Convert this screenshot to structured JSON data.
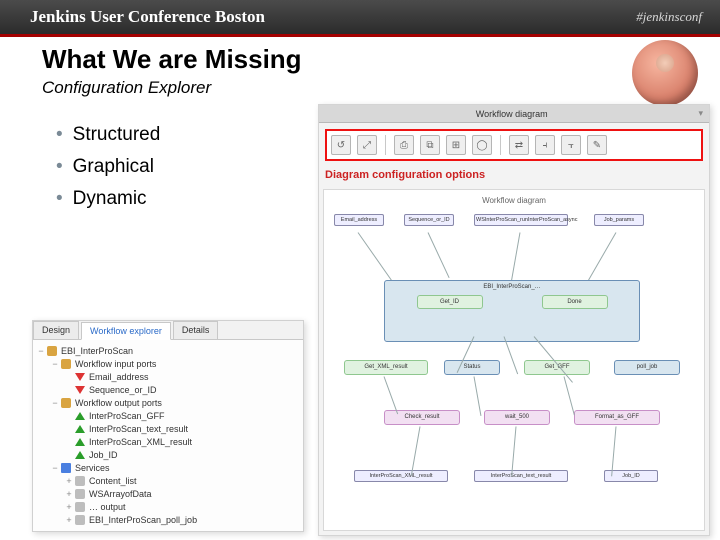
{
  "header": {
    "title": "Jenkins User Conference Boston",
    "tag": "#jenkinsconf"
  },
  "title": "What We are Missing",
  "subtitle": "Configuration Explorer",
  "bullets": [
    "Structured",
    "Graphical",
    "Dynamic"
  ],
  "left": {
    "tabs": [
      "Design",
      "Workflow explorer",
      "Details"
    ],
    "active_tab_index": 1,
    "tree": [
      {
        "lvl": 0,
        "tw": "−",
        "icon": "fld",
        "label": "EBI_InterProScan"
      },
      {
        "lvl": 1,
        "tw": "−",
        "icon": "fld",
        "label": "Workflow input ports"
      },
      {
        "lvl": 2,
        "tw": "",
        "icon": "dn",
        "label": "Email_address"
      },
      {
        "lvl": 2,
        "tw": "",
        "icon": "dn",
        "label": "Sequence_or_ID"
      },
      {
        "lvl": 1,
        "tw": "−",
        "icon": "fld",
        "label": "Workflow output ports"
      },
      {
        "lvl": 2,
        "tw": "",
        "icon": "up",
        "label": "InterProScan_GFF"
      },
      {
        "lvl": 2,
        "tw": "",
        "icon": "up",
        "label": "InterProScan_text_result"
      },
      {
        "lvl": 2,
        "tw": "",
        "icon": "up",
        "label": "InterProScan_XML_result"
      },
      {
        "lvl": 2,
        "tw": "",
        "icon": "up",
        "label": "Job_ID"
      },
      {
        "lvl": 1,
        "tw": "−",
        "icon": "svc",
        "label": "Services"
      },
      {
        "lvl": 2,
        "tw": "+",
        "icon": "doc",
        "label": "Content_list"
      },
      {
        "lvl": 2,
        "tw": "+",
        "icon": "doc",
        "label": "WSArrayofData"
      },
      {
        "lvl": 2,
        "tw": "+",
        "icon": "doc",
        "label": "… output"
      },
      {
        "lvl": 2,
        "tw": "+",
        "icon": "doc",
        "label": "EBI_InterProScan_poll_job"
      }
    ]
  },
  "right": {
    "title_tab": "Workflow diagram",
    "toolbar_icons": [
      "↺",
      "⤢",
      "⎙",
      "⧉",
      "⊞",
      "◯",
      "⇄",
      "⫞",
      "⫟",
      "✎"
    ],
    "caption": "Diagram configuration options",
    "canvas_title": "Workflow diagram",
    "inputs": [
      "Email_address",
      "Sequence_or_ID",
      "WSInterProScan_runInterProScan_async",
      "Job_params"
    ],
    "row_ebi": {
      "label": "EBI_InterProScan_…",
      "sub1": "Get_ID",
      "sub2": "Done"
    },
    "row_mid": [
      "Get_XML_result",
      "Status",
      "Get_GFF",
      "poll_job"
    ],
    "row_low": [
      "Check_result",
      "wait_500",
      "Format_as_GFF"
    ],
    "outputs": [
      "InterProScan_XML_result",
      "InterProScan_text_result",
      "Job_ID"
    ]
  }
}
